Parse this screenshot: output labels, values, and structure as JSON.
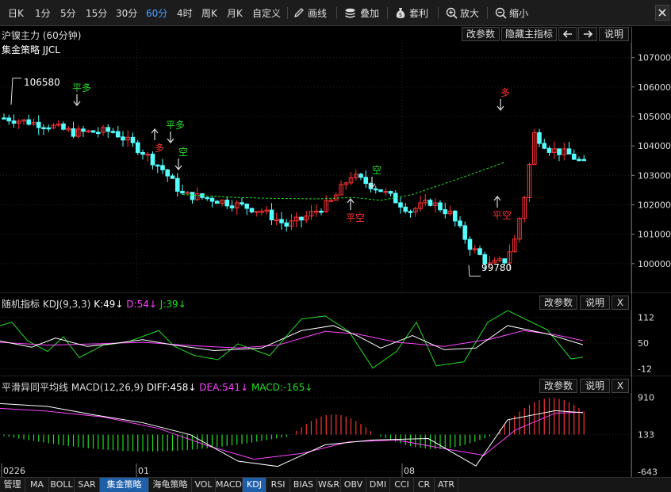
{
  "toolbar": {
    "periods": [
      "日K",
      "1分",
      "5分",
      "15分",
      "30分",
      "60分",
      "4时",
      "周K",
      "月K",
      "自定义"
    ],
    "active_period": "60分",
    "actions": {
      "draw": "画线",
      "overlay": "叠加",
      "arbitrage": "套利",
      "zoom_in": "放大",
      "zoom_out": "缩小"
    }
  },
  "main": {
    "title": "沪镍主力 (60分钟)",
    "strategy": "集金策略 JJCL",
    "buttons": {
      "params": "改参数",
      "hide": "隐藏主指标",
      "help": "说明"
    },
    "high_label": "106580",
    "low_label": "99780",
    "signals": [
      "平多",
      "多",
      "平多",
      "空",
      "平空",
      "空",
      "多",
      "平空"
    ],
    "y_axis": [
      "107000",
      "106000",
      "105000",
      "104000",
      "103000",
      "102000",
      "101000",
      "100000"
    ],
    "y_range": [
      99000,
      107500
    ]
  },
  "kdj": {
    "name": "随机指标",
    "params": "KDJ(9,3,3)",
    "k": "K:49↓",
    "d": "D:54↓",
    "j": "J:39↓",
    "buttons": {
      "params": "改参数",
      "help": "说明",
      "close": "X"
    },
    "y_axis": [
      "112",
      "50",
      "-12"
    ]
  },
  "macd": {
    "name": "平滑异同平均线",
    "params": "MACD(12,26,9)",
    "diff": "DIFF:458↓",
    "dea": "DEA:541↓",
    "macd": "MACD:-165↓",
    "buttons": {
      "params": "改参数",
      "help": "说明",
      "close": "X"
    },
    "y_axis": [
      "910",
      "133",
      "-643"
    ]
  },
  "x_axis": [
    "0226",
    "01",
    "08"
  ],
  "bottom_tabs": [
    "管理",
    "MA",
    "BOLL",
    "SAR",
    "集金策略",
    "海龟策略",
    "VOL",
    "MACD",
    "KDJ",
    "RSI",
    "BIAS",
    "W&R",
    "OBV",
    "DMI",
    "CCI",
    "CR",
    "ATR"
  ],
  "active_bottom_tabs": [
    "集金策略",
    "KDJ"
  ],
  "colors": {
    "up": "#ff3232",
    "down": "#54ffff",
    "diff": "#ffffff",
    "dea": "#ff44ff",
    "kdj_j": "#22dd22",
    "signal_buy": "#ff3232",
    "signal_sell": "#22dd22",
    "dash": "#22dd22",
    "active_tab": "#1f5fa8"
  }
}
